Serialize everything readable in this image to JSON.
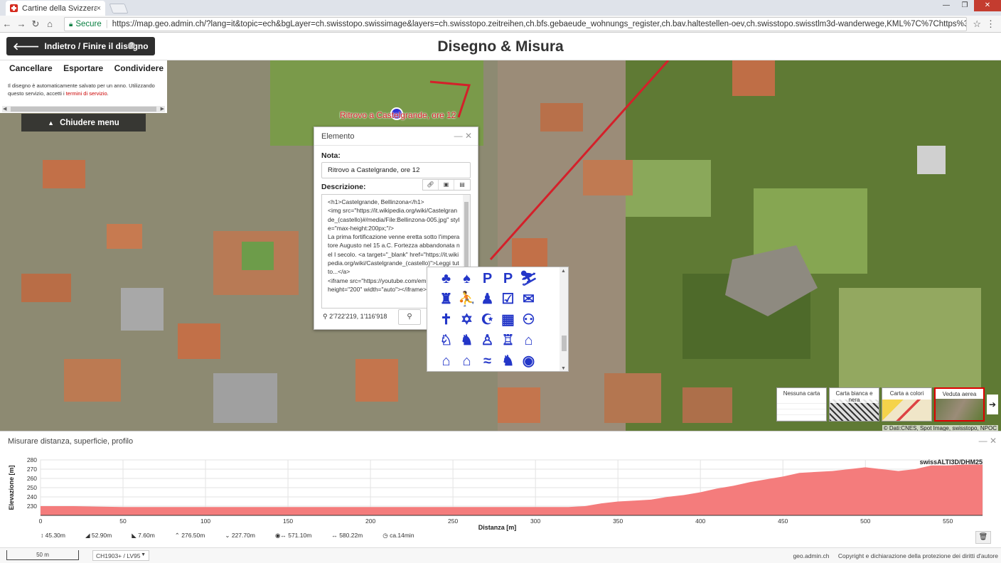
{
  "browser": {
    "tab_title": "Cartine della Svizzera - G",
    "tab_close": "×",
    "secure_label": "Secure",
    "url": "https://map.geo.admin.ch/?lang=it&topic=ech&bgLayer=ch.swisstopo.swissimage&layers=ch.swisstopo.zeitreihen,ch.bfs.gebaeude_wohnungs_register,ch.bav.haltestellen-oev,ch.swisstopo.swisstlm3d-wanderwege,KML%7C%7Chttps%3A%2F%2Fpublic.geo.admin.ch%2Fp"
  },
  "header": {
    "back_label": "Indietro / Finire il disegno",
    "title": "Disegno & Misura"
  },
  "sidepanel": {
    "tabs": [
      "Cancellare",
      "Esportare",
      "Condividere"
    ],
    "info_text": "Il disegno è automaticamente salvato per un anno. Utilizzando questo servizio, accetti i ",
    "info_link": "termini di servizio",
    "info_end": ".",
    "close_menu": "Chiudere menu"
  },
  "map": {
    "feature_label": "Ritrovo a Castelgrande, ore 12"
  },
  "popup": {
    "title": "Elemento",
    "note_label": "Nota:",
    "note_value": "Ritrovo a Castelgrande, ore 12",
    "desc_label": "Descrizione:",
    "desc_value": "<h1>Castelgrande, Bellinzona</h1>\n<img src=\"https://it.wikipedia.org/wiki/Castelgrande_(castello)#/media/File:Bellinzona-005.jpg\" style=\"max-height:200px;\"/>\nLa prima fortificazione venne eretta sotto l'imperatore Augusto nel 15 a.C. Fortezza abbandonata nel I secolo. <a target=\"_blank\" href=\"https://it.wikipedia.org/wiki/Castelgrande_(castello)\">Leggi tutto...</a>\n<iframe src=\"https://youtube.com/embed/ekGa0\" height=\"200\" width=\"auto\"></iframe>",
    "coords": "2'722'219, 1'116'918"
  },
  "icon_picker": {
    "icons": [
      "♣",
      "♠",
      "P",
      "P",
      "⛷",
      "♜",
      "⛹",
      "♟",
      "☑",
      "✉",
      "✝",
      "✡",
      "☪",
      "▦",
      "⚇",
      "♘",
      "♞",
      "♙",
      "♖",
      "⌂",
      "⌂",
      "⌂",
      "≈",
      "♞",
      "◉"
    ]
  },
  "basemaps": {
    "items": [
      "Nessuna carta",
      "Carta bianca e nera",
      "Carta a colori",
      "Veduta aerea"
    ],
    "attribution": "© Dati:CNES, Spot Image, swisstopo, NPOC"
  },
  "profile": {
    "title": "Misurare distanza, superficie, profilo",
    "dataset": "swissALTI3D/DHM25",
    "stats": [
      "45.30m",
      "52.90m",
      "7.60m",
      "276.50m",
      "227.70m",
      "571.10m",
      "580.22m",
      "ca.14min"
    ]
  },
  "chart_data": {
    "type": "area",
    "xlabel": "Distanza [m]",
    "ylabel": "Elevazione [m]",
    "xlim": [
      0,
      571
    ],
    "ylim": [
      220,
      280
    ],
    "xticks": [
      0,
      50,
      100,
      150,
      200,
      250,
      300,
      350,
      400,
      450,
      500,
      550
    ],
    "yticks": [
      230,
      240,
      250,
      260,
      270,
      280
    ],
    "color": "#f47c7c",
    "series": [
      {
        "x": [
          0,
          20,
          50,
          80,
          100,
          130,
          150,
          180,
          200,
          230,
          250,
          270,
          300,
          320,
          330,
          340,
          350,
          360,
          370,
          380,
          390,
          400,
          410,
          420,
          430,
          440,
          450,
          460,
          470,
          480,
          490,
          500,
          510,
          520,
          530,
          540,
          550,
          560,
          571
        ],
        "values": [
          230,
          230,
          229,
          229,
          229,
          229,
          229,
          229,
          229,
          229,
          229,
          229,
          229,
          229,
          230,
          233,
          235,
          236,
          237,
          240,
          242,
          245,
          249,
          252,
          256,
          259,
          262,
          266,
          267,
          268,
          270,
          272,
          270,
          268,
          270,
          274,
          274,
          275,
          275
        ]
      }
    ]
  },
  "footer": {
    "scale": "50 m",
    "crs": "CH1903+ / LV95",
    "site": "geo.admin.ch",
    "copyright": "Copyright e dichiarazione della protezione dei diritti d'autore"
  }
}
